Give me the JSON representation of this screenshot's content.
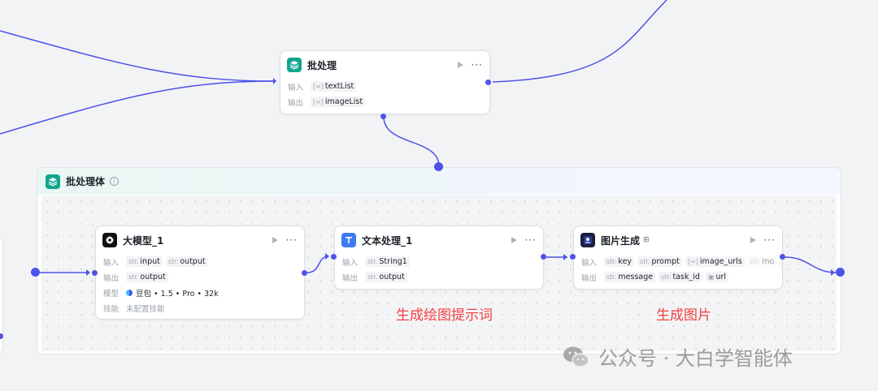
{
  "batch_node": {
    "title": "批处理",
    "input_label": "输入",
    "output_label": "输出",
    "inputs": [
      {
        "type": "[∞]",
        "name": "textList"
      }
    ],
    "outputs": [
      {
        "type": "[∞]",
        "name": "imageList"
      }
    ]
  },
  "group": {
    "title": "批处理体"
  },
  "llm_node": {
    "title": "大模型_1",
    "input_label": "输入",
    "output_label": "输出",
    "model_label": "模型",
    "skill_label": "技能",
    "inputs": [
      {
        "type": "str.",
        "name": "input"
      },
      {
        "type": "str.",
        "name": "output"
      }
    ],
    "outputs": [
      {
        "type": "str.",
        "name": "output"
      }
    ],
    "model_value": "豆包 • 1.5 • Pro • 32k",
    "skill_value": "未配置技能"
  },
  "text_node": {
    "title": "文本处理_1",
    "input_label": "输入",
    "output_label": "输出",
    "inputs": [
      {
        "type": "str.",
        "name": "String1"
      }
    ],
    "outputs": [
      {
        "type": "str.",
        "name": "output"
      }
    ]
  },
  "image_node": {
    "title": "图片生成",
    "input_label": "输入",
    "output_label": "输出",
    "inputs": [
      {
        "type": "str.",
        "name": "key"
      },
      {
        "type": "str.",
        "name": "prompt"
      },
      {
        "type": "[∞]",
        "name": "image_urls"
      },
      {
        "type": "str.",
        "name": "mo"
      }
    ],
    "outputs": [
      {
        "type": "str.",
        "name": "message"
      },
      {
        "type": "str.",
        "name": "task_id"
      },
      {
        "type": "▣",
        "name": "url"
      }
    ],
    "more_inputs": "···"
  },
  "annotations": {
    "prompt_note": "生成绘图提示词",
    "image_note": "生成图片"
  },
  "watermark": "公众号 · 大白学智能体",
  "colors": {
    "edge": "#4d53e8",
    "annotation": "#f53f3f",
    "batch_icon": "#10a68e",
    "text_icon": "#3d7bf5"
  }
}
